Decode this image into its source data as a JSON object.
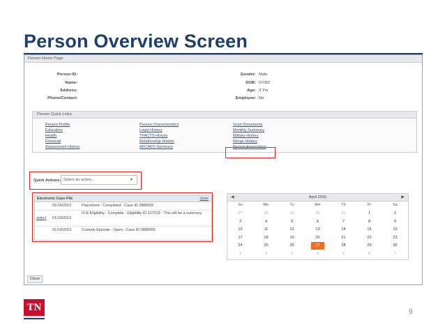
{
  "slide": {
    "title": "Person Overview Screen",
    "page_number": "9",
    "logo_text": "TN"
  },
  "screen": {
    "header": "Person Home Page",
    "fields_left": [
      {
        "label": "Person ID:",
        "value": ""
      },
      {
        "label": "Name:",
        "value": ""
      },
      {
        "label": "Address:",
        "value": ""
      },
      {
        "label": "Phone/Contact:",
        "value": ""
      }
    ],
    "fields_right": [
      {
        "label": "Gender:",
        "value": "Male"
      },
      {
        "label": "DOB:",
        "value": "07/30/"
      },
      {
        "label": "Age:",
        "value": "3 Yrs"
      },
      {
        "label": "Employee:",
        "value": "No"
      }
    ],
    "quick_links": {
      "header": "Person Quick Links",
      "col1": [
        "Person Profile",
        "Education",
        "Health",
        "Financial",
        "Assessment History"
      ],
      "col2": [
        "Person Characteristics",
        "Legal History",
        "TFACTS History",
        "Relationship History",
        "AFCARS Summary"
      ],
      "col3": [
        "Scan Documents",
        "Monthly Summary",
        "Military History",
        "Merge History",
        "Person Association"
      ]
    },
    "quick_actions": {
      "label": "Quick Actions:",
      "select_value": "Select an action..."
    },
    "case_file": {
      "title": "Electronic Case File",
      "close_label": "close",
      "rows": [
        {
          "select": "",
          "date": "01/14/2013",
          "desc": "Placement - Completed - Case ID 2886655"
        },
        {
          "select": "select",
          "date": "01/14/2013",
          "desc": "IV-E Eligibility - Complete - Eligibility ID 317019 - This will be a summary."
        },
        {
          "select": "",
          "date": "01/14/2013",
          "desc": "Custody Episode - Open - Case ID 2886655"
        }
      ]
    },
    "calendar": {
      "title": "April 2016",
      "prev": "◀",
      "next": "▶",
      "days_of_week": [
        "Su",
        "Mo",
        "Tu",
        "We",
        "Th",
        "Fr",
        "Sa"
      ],
      "weeks": [
        [
          "27",
          "28",
          "29",
          "30",
          "31",
          "1",
          "2"
        ],
        [
          "3",
          "4",
          "5",
          "6",
          "7",
          "8",
          "9"
        ],
        [
          "10",
          "11",
          "12",
          "13",
          "14",
          "15",
          "16"
        ],
        [
          "17",
          "18",
          "19",
          "20",
          "21",
          "22",
          "23"
        ],
        [
          "24",
          "25",
          "26",
          "27",
          "28",
          "29",
          "30"
        ],
        [
          "1",
          "2",
          "3",
          "4",
          "5",
          "6",
          "7"
        ]
      ],
      "today": "27"
    },
    "close_button": "Close"
  }
}
